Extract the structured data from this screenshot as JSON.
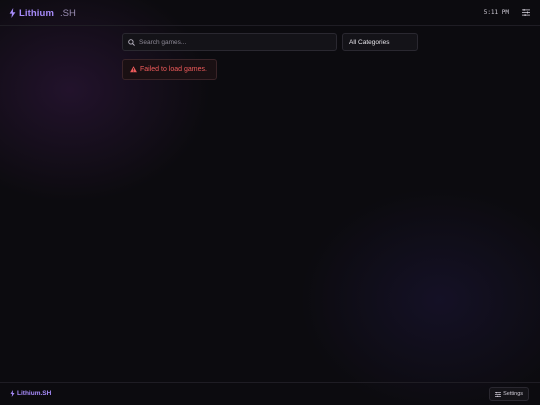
{
  "header": {
    "brand_name": "Lithium",
    "brand_suffix": ".SH",
    "clock": "5:11 PM",
    "menu_icon": "sliders-icon"
  },
  "search": {
    "placeholder": "Search games...",
    "value": "",
    "icon": "search-icon"
  },
  "filter": {
    "selected": "All Categories"
  },
  "error": {
    "message": "Failed to load games.",
    "icon": "warning-icon"
  },
  "footer": {
    "brand": "Lithium.SH",
    "settings_label": "Settings",
    "settings_icon": "settings-icon"
  },
  "colors": {
    "accent": "#a78bfa",
    "error": "#ef5b5b",
    "background": "#0c0b0f"
  }
}
